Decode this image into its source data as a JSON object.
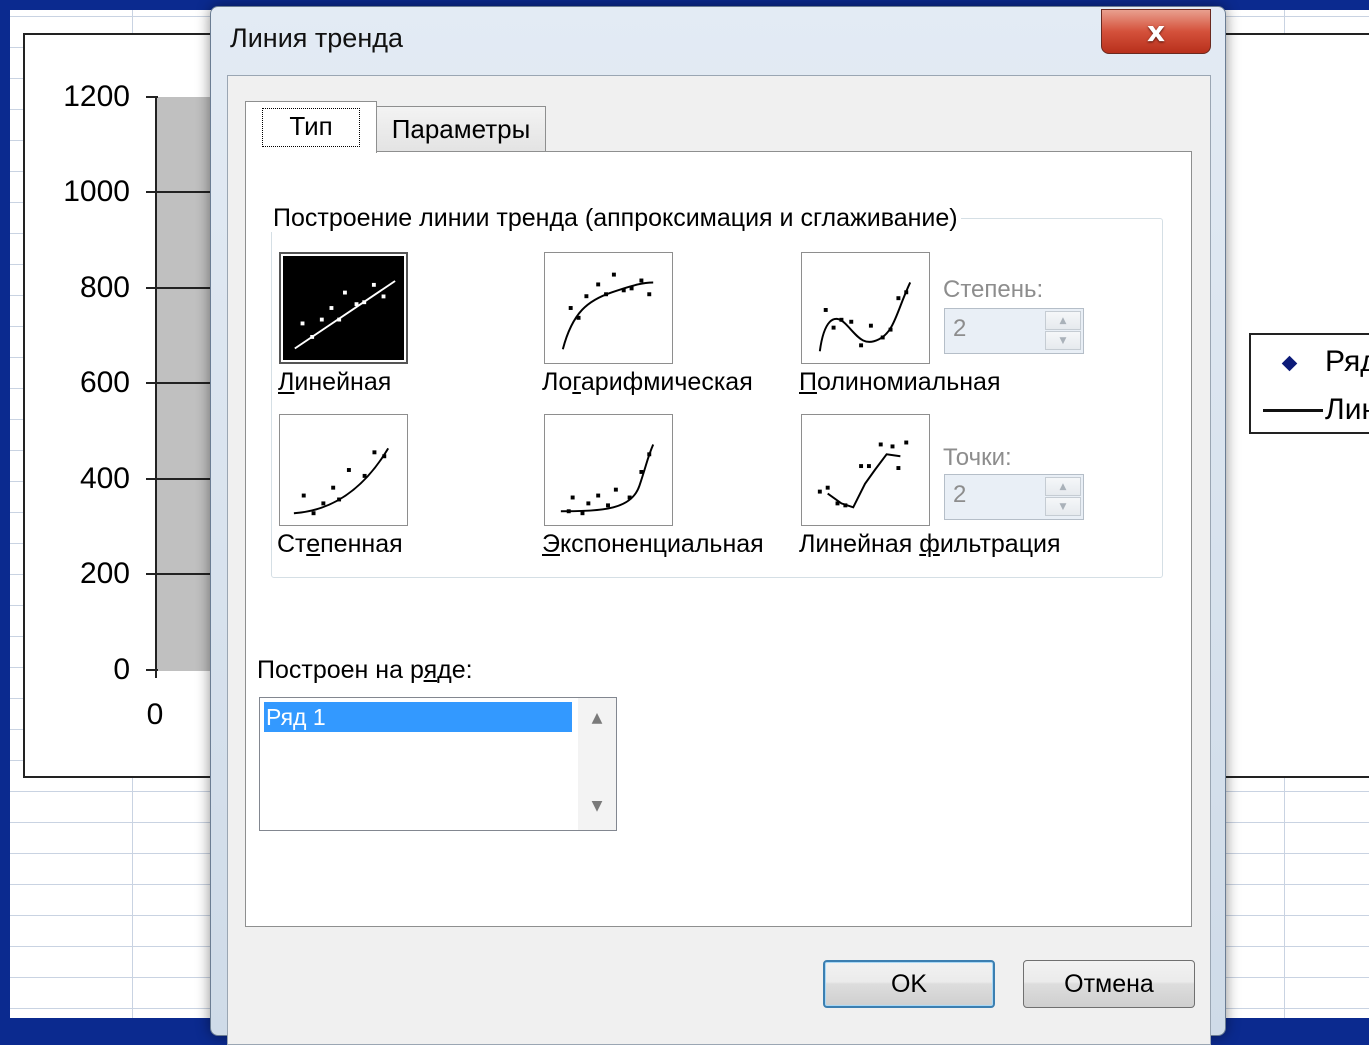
{
  "background_chart": {
    "y_ticks": [
      "1200",
      "1000",
      "800",
      "600",
      "400",
      "200",
      "0"
    ],
    "x_tick": "0",
    "legend": {
      "series_marker": "diamond-marker",
      "series_text": "Ряд",
      "trendline_text": "Лин"
    }
  },
  "dialog": {
    "title": "Линия тренда",
    "close_glyph": "x",
    "tabs": [
      {
        "label": "Тип"
      },
      {
        "label": "Параметры"
      }
    ],
    "group_title": "Построение линии тренда (аппроксимация и сглаживание)",
    "types": [
      {
        "label_pre": "",
        "label_u": "Л",
        "label_post": "инейная",
        "icon": "linear-trend-icon",
        "selected": true
      },
      {
        "label_pre": "Ло",
        "label_u": "г",
        "label_post": "арифмическая",
        "icon": "logarithmic-trend-icon"
      },
      {
        "label_pre": "",
        "label_u": "П",
        "label_post": "олиномиальная",
        "icon": "polynomial-trend-icon"
      },
      {
        "label_pre": "Ст",
        "label_u": "е",
        "label_post": "пенная",
        "icon": "power-trend-icon"
      },
      {
        "label_pre": "",
        "label_u": "Э",
        "label_post": "кспоненциальная",
        "icon": "exponential-trend-icon"
      },
      {
        "label_pre": "Линейная ",
        "label_u": "ф",
        "label_post": "ильтрация",
        "icon": "moving-average-trend-icon"
      }
    ],
    "degree": {
      "label": "Степень:",
      "value": "2"
    },
    "period": {
      "label": "Точки:",
      "value": "2"
    },
    "series_label_pre": "Построен на р",
    "series_label_u": "я",
    "series_label_post": "де:",
    "series_items": [
      "Ряд 1"
    ],
    "ok_label": "OK",
    "cancel_label": "Отмена"
  }
}
